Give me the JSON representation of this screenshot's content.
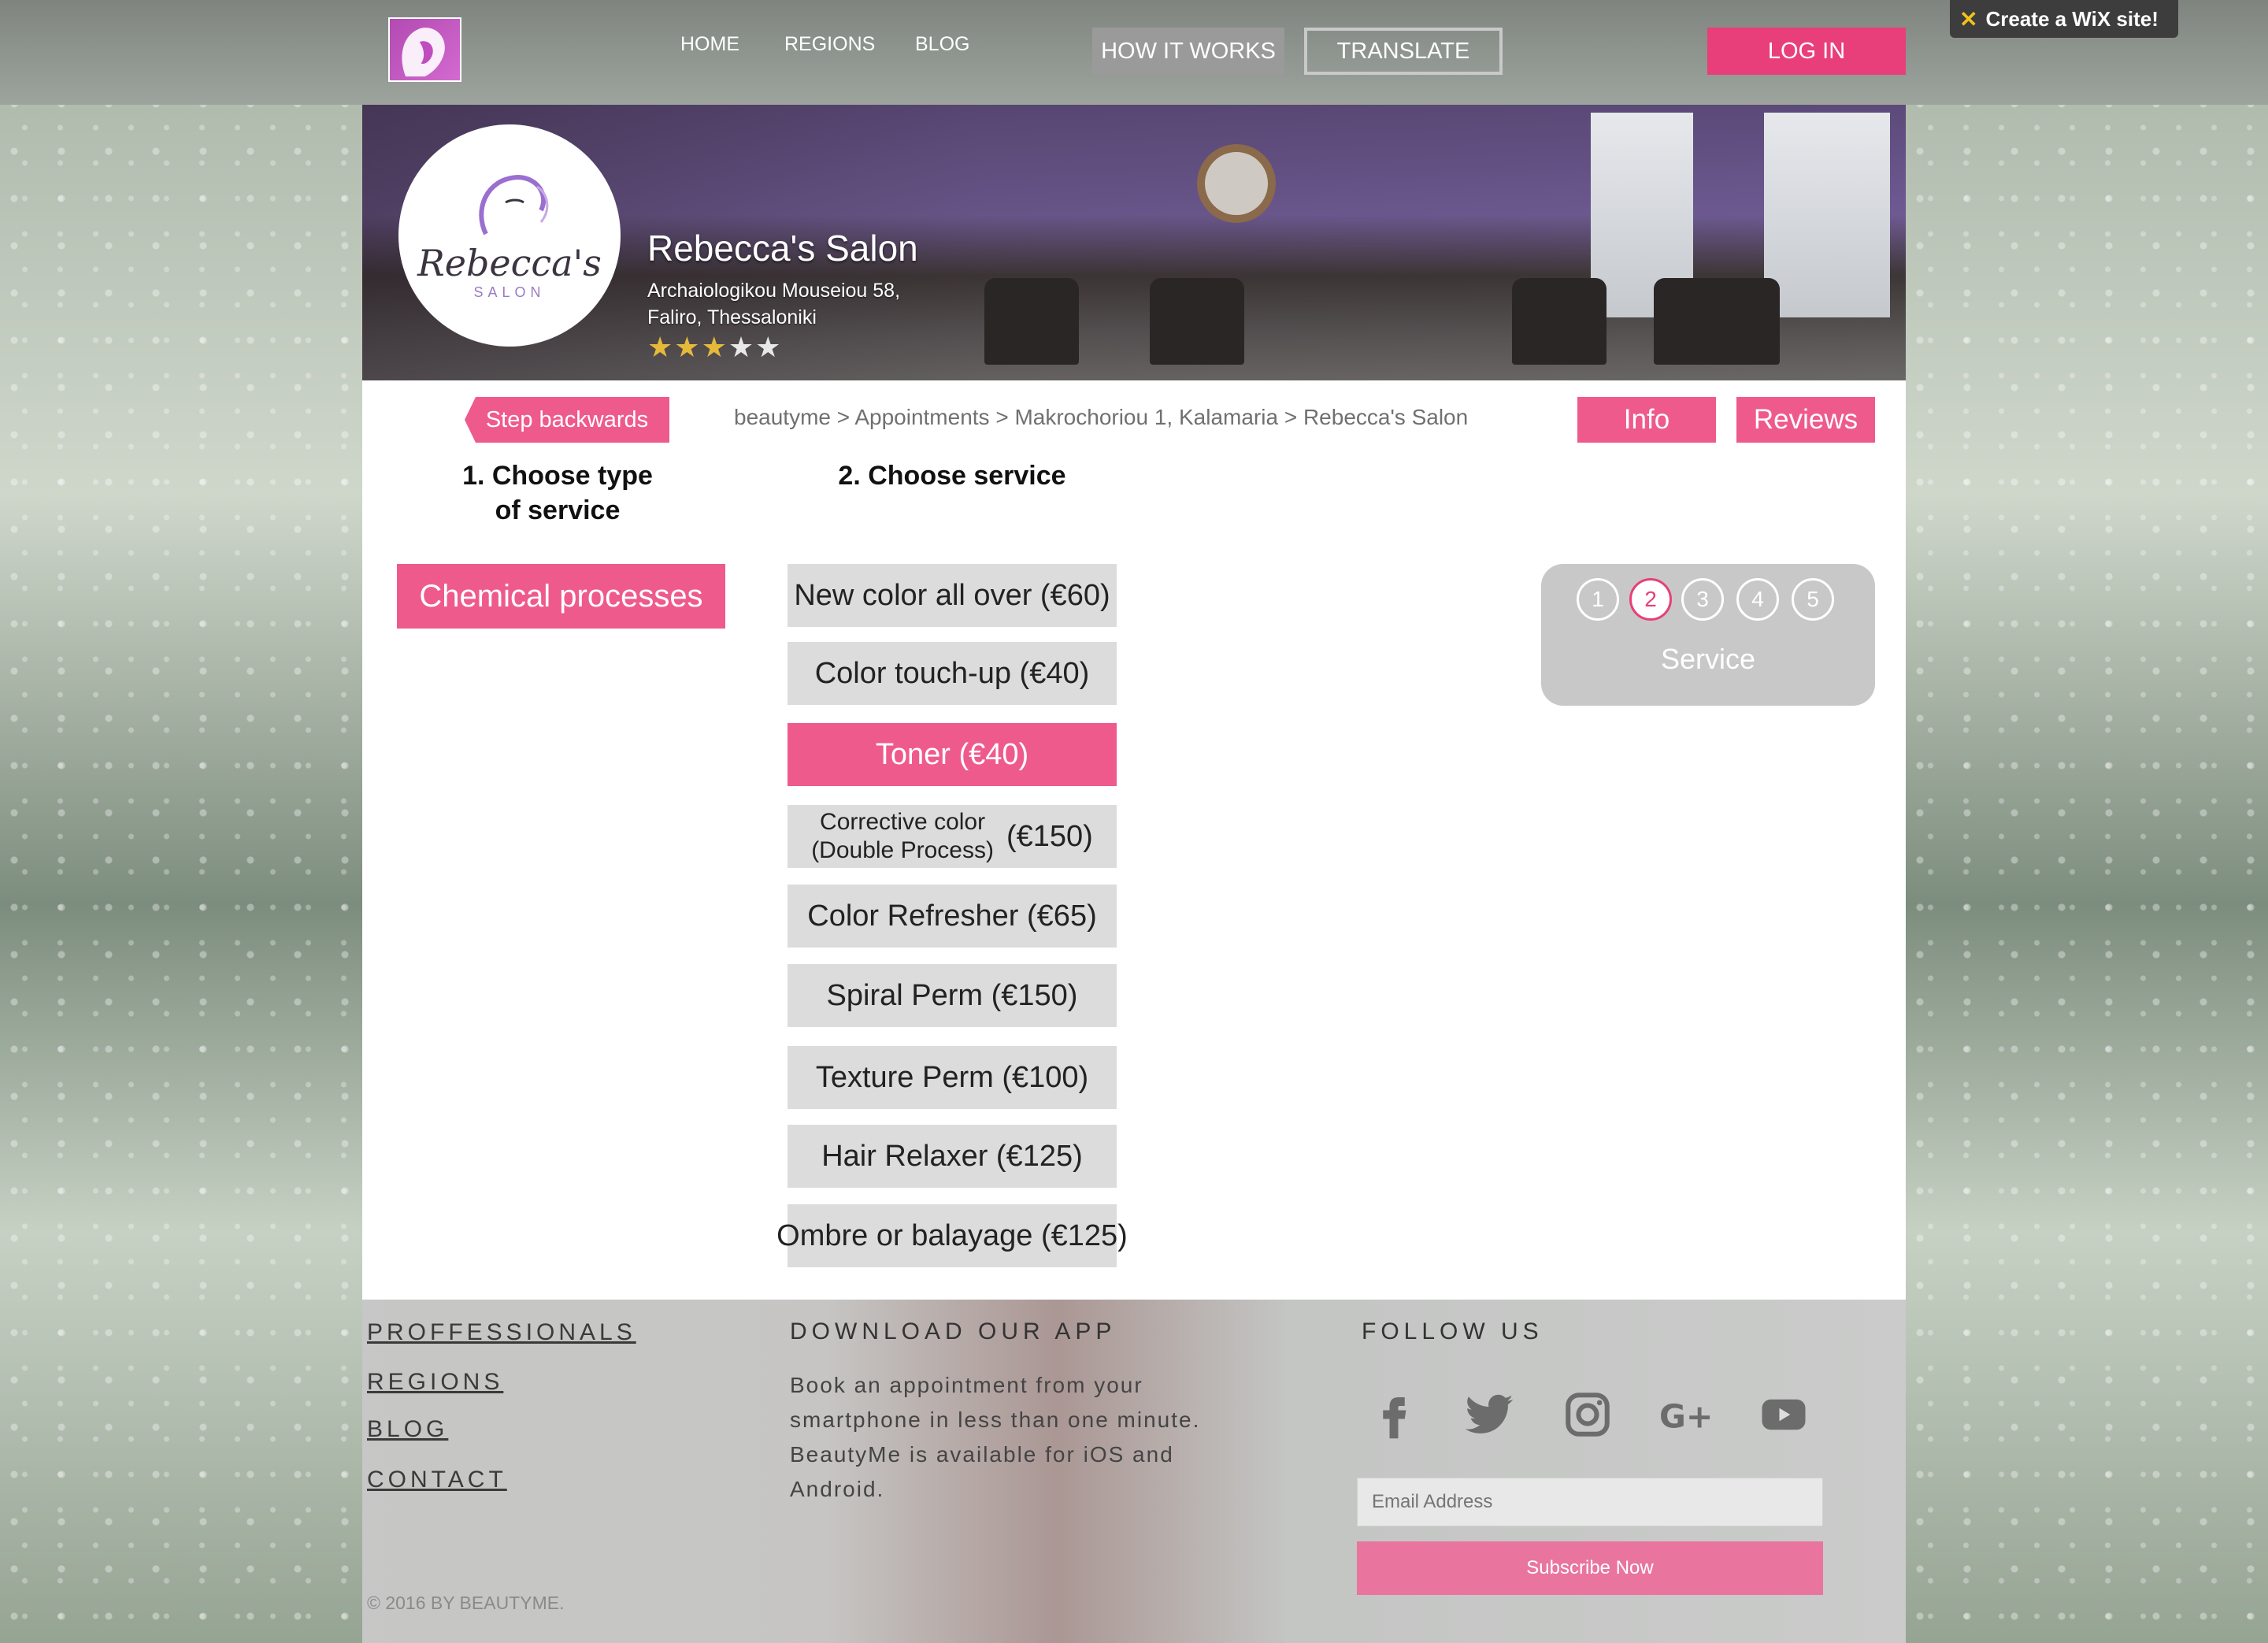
{
  "nav": {
    "home": "HOME",
    "regions": "REGIONS",
    "blog": "BLOG",
    "how_it_works": "HOW IT WORKS",
    "translate": "TRANSLATE",
    "login": "LOG IN"
  },
  "wix_badge": {
    "text": "Create a WiX site!"
  },
  "salon": {
    "logo_name": "Rebecca's",
    "logo_sub": "SALON",
    "name": "Rebecca's Salon",
    "address_line1": "Archaiologikou Mouseiou 58,",
    "address_line2": "Faliro, Thessaloniki",
    "rating": 3,
    "rating_max": 5
  },
  "toolbar": {
    "step_backwards": "Step backwards",
    "breadcrumb": "beautyme > Appointments > Makrochoriou 1, Kalamaria > Rebecca's Salon",
    "info": "Info",
    "reviews": "Reviews"
  },
  "steps": {
    "choose_type_line1": "1. Choose type",
    "choose_type_line2": "of service",
    "choose_service": "2. Choose service"
  },
  "service_type": "Chemical processes",
  "services": [
    {
      "label": "New color all over (€60)"
    },
    {
      "label": "Color touch-up (€40)"
    },
    {
      "label": "Toner (€40)",
      "selected": true
    },
    {
      "label_line1": "Corrective color",
      "label_line2": "(Double Process)",
      "price": "(€150)"
    },
    {
      "label": "Color Refresher (€65)"
    },
    {
      "label": "Spiral Perm (€150)"
    },
    {
      "label": "Texture Perm (€100)"
    },
    {
      "label": "Hair Relaxer (€125)"
    },
    {
      "label": "Ombre or balayage (€125)"
    }
  ],
  "progress": {
    "steps": [
      "1",
      "2",
      "3",
      "4",
      "5"
    ],
    "active_step": 2,
    "label": "Service"
  },
  "footer": {
    "links": [
      "PROFFESSIONALS",
      "REGIONS",
      "BLOG",
      "CONTACT"
    ],
    "download_heading": "DOWNLOAD OUR APP",
    "download_text": "Book an appointment from your smartphone in less than one minute. BeautyMe is available for iOS and Android.",
    "follow_heading": "FOLLOW US",
    "social_icons": [
      "facebook-icon",
      "twitter-icon",
      "instagram-icon",
      "google-plus-icon",
      "youtube-icon"
    ],
    "email_placeholder": "Email Address",
    "subscribe": "Subscribe Now",
    "copyright": "© 2016 BY BEAUTYME."
  },
  "colors": {
    "accent": "#ef5a8c",
    "login": "#e83f7a",
    "service_bg": "#dcdcdc",
    "progress_bg": "#c8c8c8"
  }
}
